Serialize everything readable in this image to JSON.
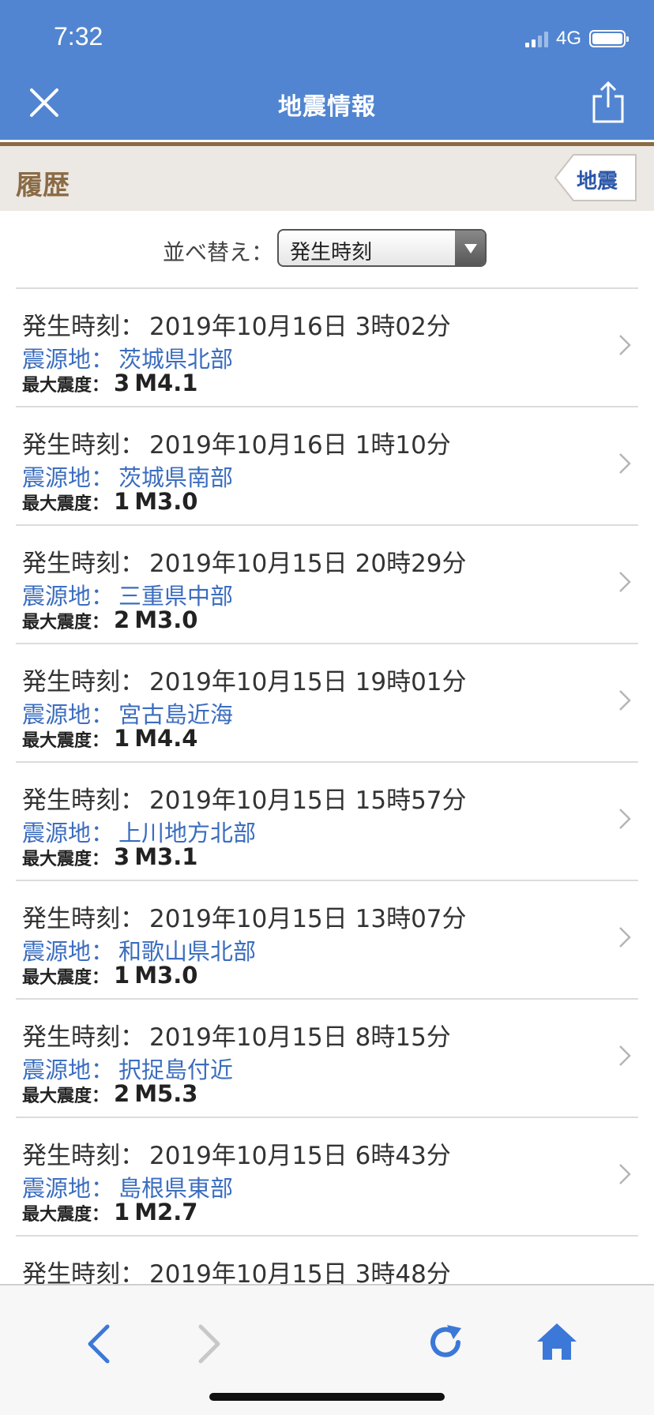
{
  "status": {
    "time": "7:32",
    "network": "4G"
  },
  "header": {
    "title": "地震情報",
    "close_icon": "close-icon",
    "share_icon": "share-icon"
  },
  "history": {
    "title": "履歴",
    "tag_label": "地震"
  },
  "sort": {
    "label": "並べ替え：",
    "value": "発生時刻"
  },
  "labels": {
    "time": "発生時刻：",
    "epicenter": "震源地：",
    "intensity": "最大震度："
  },
  "colors": {
    "header": "#5185d1",
    "accent_brown": "#8a6b45",
    "link_blue": "#3b6dbf"
  },
  "earthquakes": [
    {
      "time": "2019年10月16日 3時02分",
      "epicenter": "茨城県北部",
      "intensity": "3",
      "magnitude": "M4.1"
    },
    {
      "time": "2019年10月16日 1時10分",
      "epicenter": "茨城県南部",
      "intensity": "1",
      "magnitude": "M3.0"
    },
    {
      "time": "2019年10月15日 20時29分",
      "epicenter": "三重県中部",
      "intensity": "2",
      "magnitude": "M3.0"
    },
    {
      "time": "2019年10月15日 19時01分",
      "epicenter": "宮古島近海",
      "intensity": "1",
      "magnitude": "M4.4"
    },
    {
      "time": "2019年10月15日 15時57分",
      "epicenter": "上川地方北部",
      "intensity": "3",
      "magnitude": "M3.1"
    },
    {
      "time": "2019年10月15日 13時07分",
      "epicenter": "和歌山県北部",
      "intensity": "1",
      "magnitude": "M3.0"
    },
    {
      "time": "2019年10月15日 8時15分",
      "epicenter": "択捉島付近",
      "intensity": "2",
      "magnitude": "M5.3"
    },
    {
      "time": "2019年10月15日 6時43分",
      "epicenter": "島根県東部",
      "intensity": "1",
      "magnitude": "M2.7"
    },
    {
      "time": "2019年10月15日 3時48分",
      "epicenter": "",
      "intensity": "",
      "magnitude": ""
    }
  ],
  "toolbar": {
    "back_icon": "back-arrow-icon",
    "forward_icon": "forward-arrow-icon",
    "reload_icon": "reload-icon",
    "home_icon": "home-icon"
  }
}
